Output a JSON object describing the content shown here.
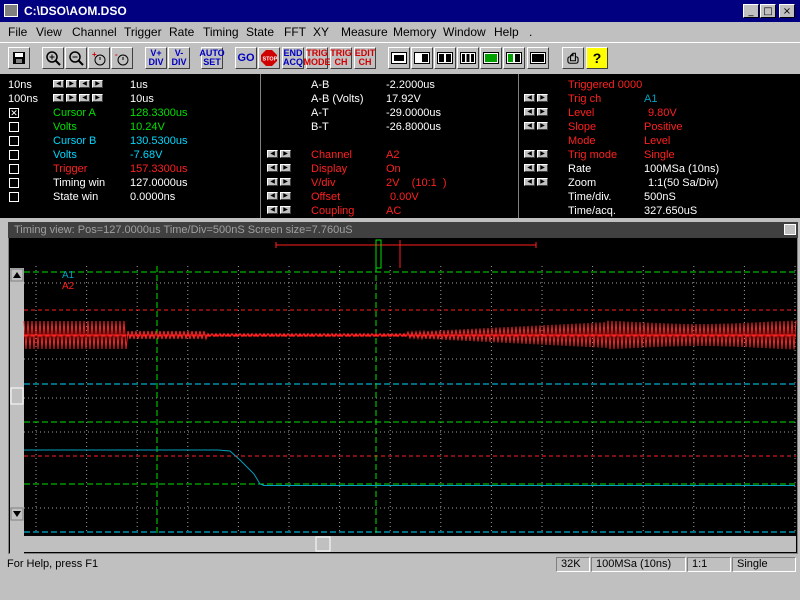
{
  "window": {
    "title": "C:\\DSO\\AOM.DSO",
    "min_glyph": "_",
    "max_glyph": "□",
    "close_glyph": "×"
  },
  "menu": [
    "File",
    "View",
    "Channel",
    "Trigger",
    "Rate",
    "Timing",
    "State",
    "FFT",
    "XY",
    "Measure",
    "Memory",
    "Window",
    "Help",
    "."
  ],
  "toolbar": {
    "vplus": [
      "V+",
      "DIV"
    ],
    "vminus": [
      "V-",
      "DIV"
    ],
    "auto": [
      "AUTO",
      "SET"
    ],
    "go": "GO",
    "stop": "STOP",
    "end": [
      "END",
      "ACQ"
    ],
    "trigmode": [
      "TRIG",
      "MODE"
    ],
    "trigch": [
      "TRIG",
      "CH"
    ],
    "editch": [
      "EDIT",
      "CH"
    ],
    "print_glyph": "⎙",
    "help_glyph": "?"
  },
  "left_panel": {
    "rows_top": [
      {
        "label": "10ns",
        "value": "1us"
      },
      {
        "label": "100ns",
        "value": "10us"
      }
    ],
    "rows": [
      {
        "label": "Cursor A",
        "value": "128.3300us",
        "color": "#00e000",
        "checked": true
      },
      {
        "label": "Volts",
        "value": "10.24V",
        "color": "#00e000",
        "checked": false
      },
      {
        "label": "Cursor B",
        "value": "130.5300us",
        "color": "#00d8ff",
        "checked": false
      },
      {
        "label": "Volts",
        "value": "-7.68V",
        "color": "#00d8ff",
        "checked": false
      },
      {
        "label": "Trigger",
        "value": "157.3300us",
        "color": "#ff2020",
        "checked": false
      },
      {
        "label": "Timing win",
        "value": "127.0000us",
        "color": "#ffffff",
        "checked": false
      },
      {
        "label": "State win",
        "value": "0.0000ns",
        "color": "#ffffff",
        "checked": false
      }
    ]
  },
  "mid_panel": {
    "measure": [
      {
        "label": "A-B",
        "value": "-2.2000us"
      },
      {
        "label": "A-B (Volts)",
        "value": "17.92V"
      },
      {
        "label": "A-T",
        "value": "-29.0000us"
      },
      {
        "label": "B-T",
        "value": "-26.8000us"
      }
    ],
    "channel": [
      {
        "label": "Channel",
        "value": "A2"
      },
      {
        "label": "Display",
        "value": "On"
      },
      {
        "label": "V/div",
        "value": "2V    (10:1  )"
      },
      {
        "label": "Offset",
        "value": "0.00V"
      },
      {
        "label": "Coupling",
        "value": "AC"
      }
    ]
  },
  "right_panel": {
    "header": "Triggered 0000",
    "trig": [
      {
        "label": "Trig ch",
        "value": "A1",
        "value_color": "#00a0c0"
      },
      {
        "label": "Level",
        "value": "9.80V",
        "value_color": "#ff2020"
      },
      {
        "label": "Slope",
        "value": "Positive",
        "value_color": "#ff2020"
      },
      {
        "label": "Mode",
        "value": "Level",
        "value_color": "#ff2020"
      },
      {
        "label": "Trig mode",
        "value": "Single",
        "value_color": "#ff2020"
      }
    ],
    "info": [
      {
        "label": "Rate",
        "value": "100MSa (10ns)"
      },
      {
        "label": "Zoom",
        "value": "1:1(50 Sa/Div)"
      },
      {
        "label": "Time/div.",
        "value": "500nS"
      },
      {
        "label": "Time/acq.",
        "value": "327.650uS"
      }
    ]
  },
  "scope": {
    "title": "Timing view: Pos=127.0000us Time/Div=500nS Screen size=7.760uS",
    "ch1_label": "A1",
    "ch2_label": "A2",
    "colors": {
      "ch1": "#00a0c0",
      "ch2": "#ff2020",
      "grid": "#a0a0a0",
      "cursorA": "#00e000",
      "cursorB": "#00d8ff",
      "trigger": "#ff2020"
    }
  },
  "status": {
    "help": "For Help, press F1",
    "mem": "32K",
    "rate": "100MSa (10ns)",
    "zoom": "1:1",
    "mode": "Single"
  }
}
